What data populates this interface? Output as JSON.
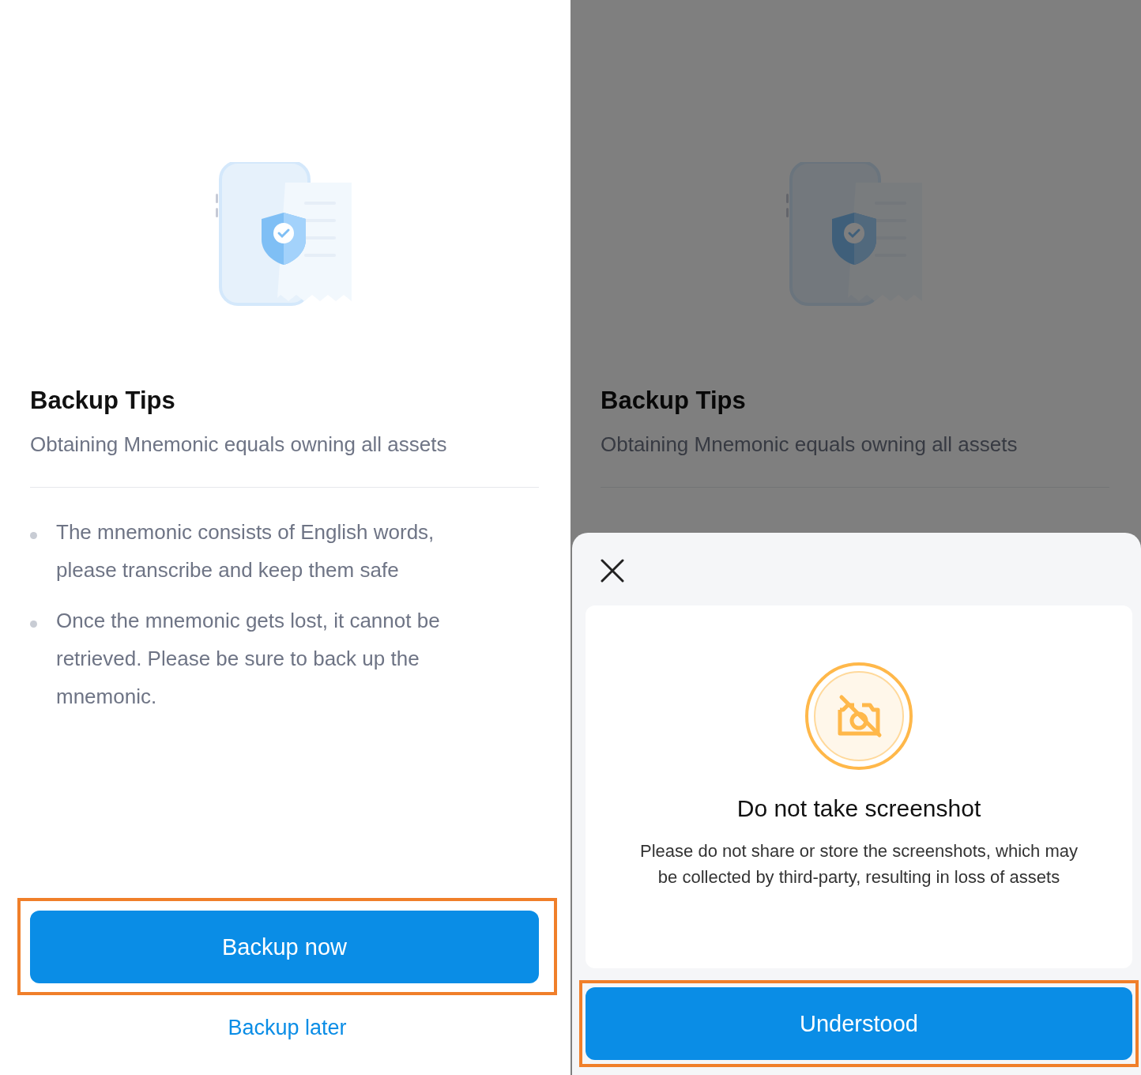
{
  "screens": [
    {
      "page": {
        "title": "Backup Tips",
        "subtitle": "Obtaining Mnemonic equals owning all assets",
        "tips": [
          "The mnemonic consists of English words, please transcribe and keep them safe",
          "Once the mnemonic gets lost, it cannot be retrieved. Please be sure to back up the mnemonic."
        ],
        "primary_button": {
          "label": "Backup now",
          "highlighted": true
        },
        "link": "Backup later"
      }
    },
    {
      "page": {
        "title": "Backup Tips",
        "subtitle": "Obtaining Mnemonic equals owning all assets"
      },
      "dialog": {
        "title": "Do not take screenshot",
        "message": "Please do not share or store the screenshots, which may be collected by third-party, resulting in loss of assets",
        "button": {
          "label": "Understood",
          "highlighted": true
        }
      }
    }
  ]
}
